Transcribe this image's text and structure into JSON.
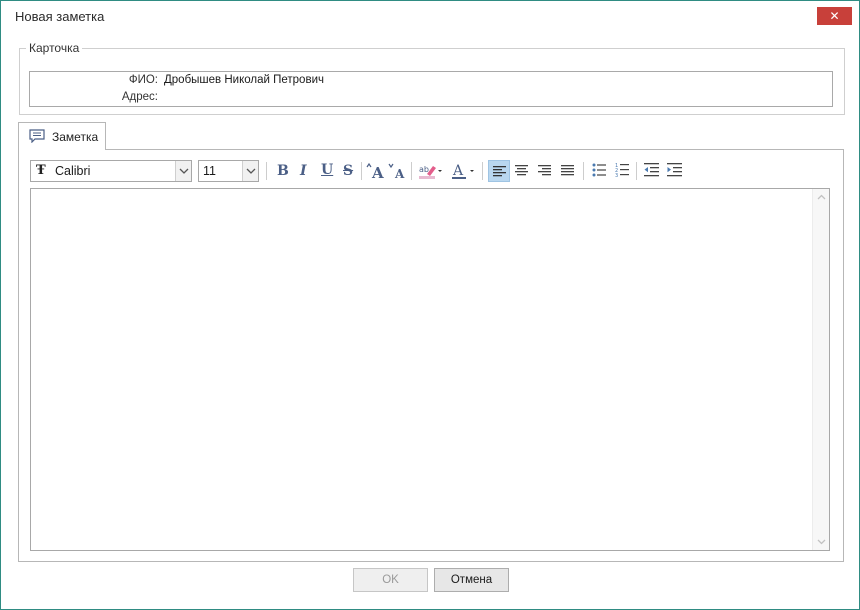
{
  "window": {
    "title": "Новая заметка",
    "close_label": "✕"
  },
  "card": {
    "legend": "Карточка",
    "fields": [
      {
        "label": "ФИО:",
        "value": "Дробышев Николай Петрович"
      },
      {
        "label": "Адрес:",
        "value": ""
      }
    ]
  },
  "tabs": [
    {
      "label": "Заметка",
      "icon": "comment-icon",
      "active": true
    }
  ],
  "toolbar": {
    "font_family": "Calibri",
    "font_size": "11",
    "buttons": [
      "bold",
      "italic",
      "underline",
      "strikethrough",
      "grow-font",
      "shrink-font",
      "highlight-color",
      "font-color",
      "align-left",
      "align-center",
      "align-right",
      "justify",
      "bullets",
      "numbering",
      "decrease-indent",
      "increase-indent"
    ],
    "active_alignment": "align-left"
  },
  "editor": {
    "content": ""
  },
  "footer": {
    "ok_label": "OK",
    "cancel_label": "Отмена",
    "ok_enabled": false
  },
  "colors": {
    "window_border": "#2f8c83",
    "close_button": "#c8403a",
    "active_button": "#b9d7ef",
    "icon_blue": "#4b5f86"
  }
}
